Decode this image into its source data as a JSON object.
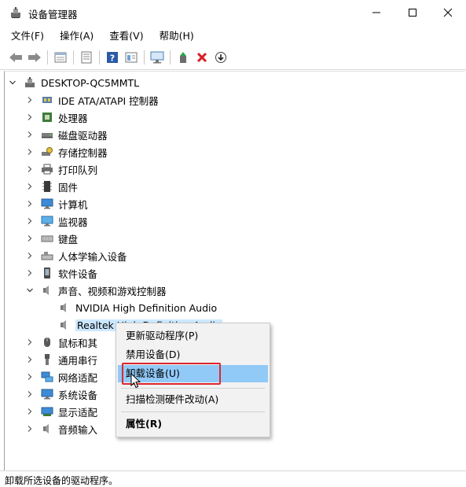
{
  "window": {
    "title": "设备管理器",
    "controls": {
      "minimize": "minimize",
      "maximize": "maximize",
      "close": "close"
    }
  },
  "menubar": {
    "items": [
      "文件(F)",
      "操作(A)",
      "查看(V)",
      "帮助(H)"
    ]
  },
  "toolbar": {
    "icons": [
      "back-arrow-icon",
      "forward-arrow-icon",
      "properties-icon",
      "list-view-icon",
      "help-icon",
      "details-icon",
      "monitor-icon",
      "update-driver-icon",
      "uninstall-x-icon",
      "download-circle-icon"
    ]
  },
  "tree": {
    "root": "DESKTOP-QC5MMTL",
    "categories": [
      {
        "label": "IDE ATA/ATAPI 控制器",
        "icon": "ide-controller-icon"
      },
      {
        "label": "处理器",
        "icon": "processor-icon"
      },
      {
        "label": "磁盘驱动器",
        "icon": "disk-drive-icon"
      },
      {
        "label": "存储控制器",
        "icon": "storage-controller-icon"
      },
      {
        "label": "打印队列",
        "icon": "printer-icon"
      },
      {
        "label": "固件",
        "icon": "firmware-icon"
      },
      {
        "label": "计算机",
        "icon": "computer-icon"
      },
      {
        "label": "监视器",
        "icon": "monitor-icon"
      },
      {
        "label": "键盘",
        "icon": "keyboard-icon"
      },
      {
        "label": "人体学输入设备",
        "icon": "hid-icon"
      },
      {
        "label": "软件设备",
        "icon": "software-device-icon"
      },
      {
        "label": "声音、视频和游戏控制器",
        "icon": "speaker-icon",
        "expanded": true
      }
    ],
    "sound_children": [
      {
        "label": "NVIDIA High Definition Audio",
        "icon": "speaker-icon"
      },
      {
        "label": "Realtek High Definition Audio",
        "icon": "speaker-icon",
        "selected": true
      }
    ],
    "after": [
      {
        "label": "鼠标和其",
        "icon": "mouse-icon"
      },
      {
        "label": "通用串行",
        "icon": "usb-icon"
      },
      {
        "label": "网络适配",
        "icon": "network-icon"
      },
      {
        "label": "系统设备",
        "icon": "system-device-icon"
      },
      {
        "label": "显示适配",
        "icon": "display-adapter-icon"
      },
      {
        "label": "音频输入",
        "icon": "audio-input-icon"
      }
    ]
  },
  "context_menu": {
    "items": [
      "更新驱动程序(P)",
      "禁用设备(D)",
      "卸载设备(U)",
      "扫描检测硬件改动(A)",
      "属性(R)"
    ],
    "highlighted": "卸载设备(U)"
  },
  "status_bar": {
    "text": "卸载所选设备的驱动程序。"
  },
  "colors": {
    "highlight": "#91c9f7",
    "selection": "#cce8ff",
    "callout": "#e0262c"
  }
}
